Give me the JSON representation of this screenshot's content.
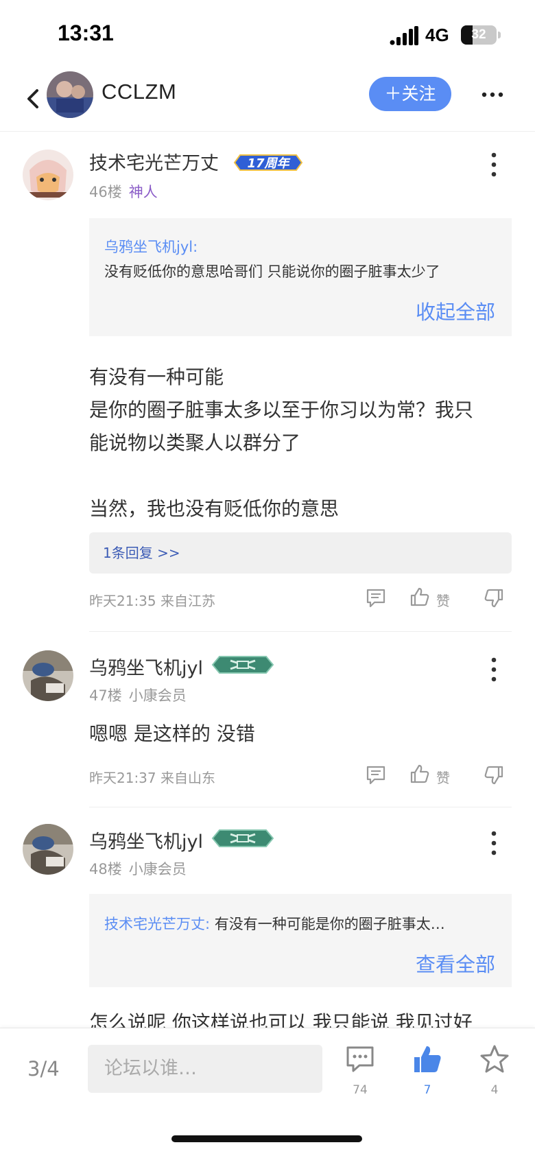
{
  "status_bar": {
    "time": "13:31",
    "network": "4G",
    "battery": "32",
    "battery_level": 0.32
  },
  "nav": {
    "title": "CCLZM",
    "follow_label": "＋关注"
  },
  "posts": [
    {
      "username": "技术宅光芒万丈",
      "badge_text": "17周年",
      "floor": "46楼",
      "user_title": "神人",
      "quote": {
        "name": "乌鸦坐飞机jyl:",
        "text": "没有贬低你的意思哈哥们  只能说你的圈子脏事太少了",
        "link": "收起全部"
      },
      "lines": [
        "有没有一种可能",
        "是你的圈子脏事太多以至于你习以为常？我只",
        "能说物以类聚人以群分了",
        "",
        "当然，我也没有贬低你的意思"
      ],
      "reply_label": "1条回复 >>",
      "meta": "昨天21:35 来自江苏",
      "like_label": "赞"
    },
    {
      "username": "乌鸦坐飞机jyl",
      "floor": "47楼",
      "user_title": "小康会员",
      "lines": [
        "嗯嗯  是这样的 没错"
      ],
      "meta": "昨天21:37 来自山东",
      "like_label": "赞"
    },
    {
      "username": "乌鸦坐飞机jyl",
      "floor": "48楼",
      "user_title": "小康会员",
      "quote": {
        "name": "技术宅光芒万丈:",
        "text": " 有没有一种可能是你的圈子脏事太…",
        "link": "查看全部"
      },
      "lines": [
        "怎么说呢 你这样说也可以 我只能说 我见过好"
      ]
    }
  ],
  "bottom": {
    "page": "3/4",
    "input_placeholder": "论坛以谁…",
    "comment_count": "74",
    "like_count": "7",
    "star_count": "4"
  },
  "colors": {
    "accent": "#5a8df4",
    "text": "#333333",
    "muted": "#999999",
    "title_purple": "#8a5cc7"
  }
}
